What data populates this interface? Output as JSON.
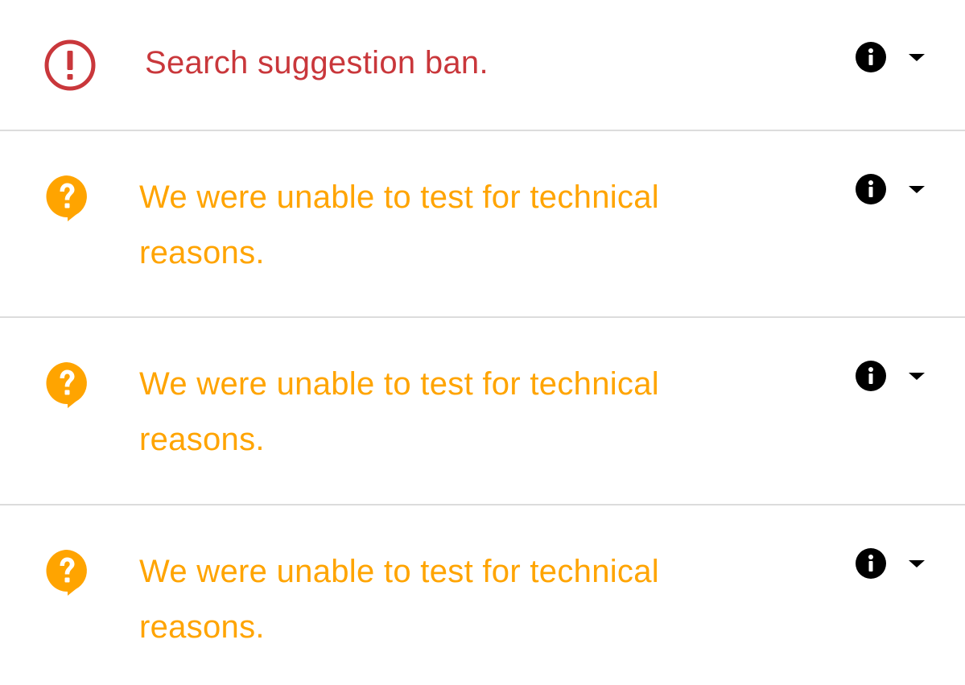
{
  "results": [
    {
      "status": "error",
      "icon": "exclamation-circle-icon",
      "color": "#c9373b",
      "message": "Search suggestion ban."
    },
    {
      "status": "unknown",
      "icon": "question-bubble-icon",
      "color": "#ffa400",
      "message": "We were unable to test for technical reasons."
    },
    {
      "status": "unknown",
      "icon": "question-bubble-icon",
      "color": "#ffa400",
      "message": "We were unable to test for technical reasons."
    },
    {
      "status": "unknown",
      "icon": "question-bubble-icon",
      "color": "#ffa400",
      "message": "We were unable to test for technical reasons."
    }
  ],
  "controls": {
    "info_icon": "info-icon",
    "expand_icon": "caret-down-icon"
  }
}
